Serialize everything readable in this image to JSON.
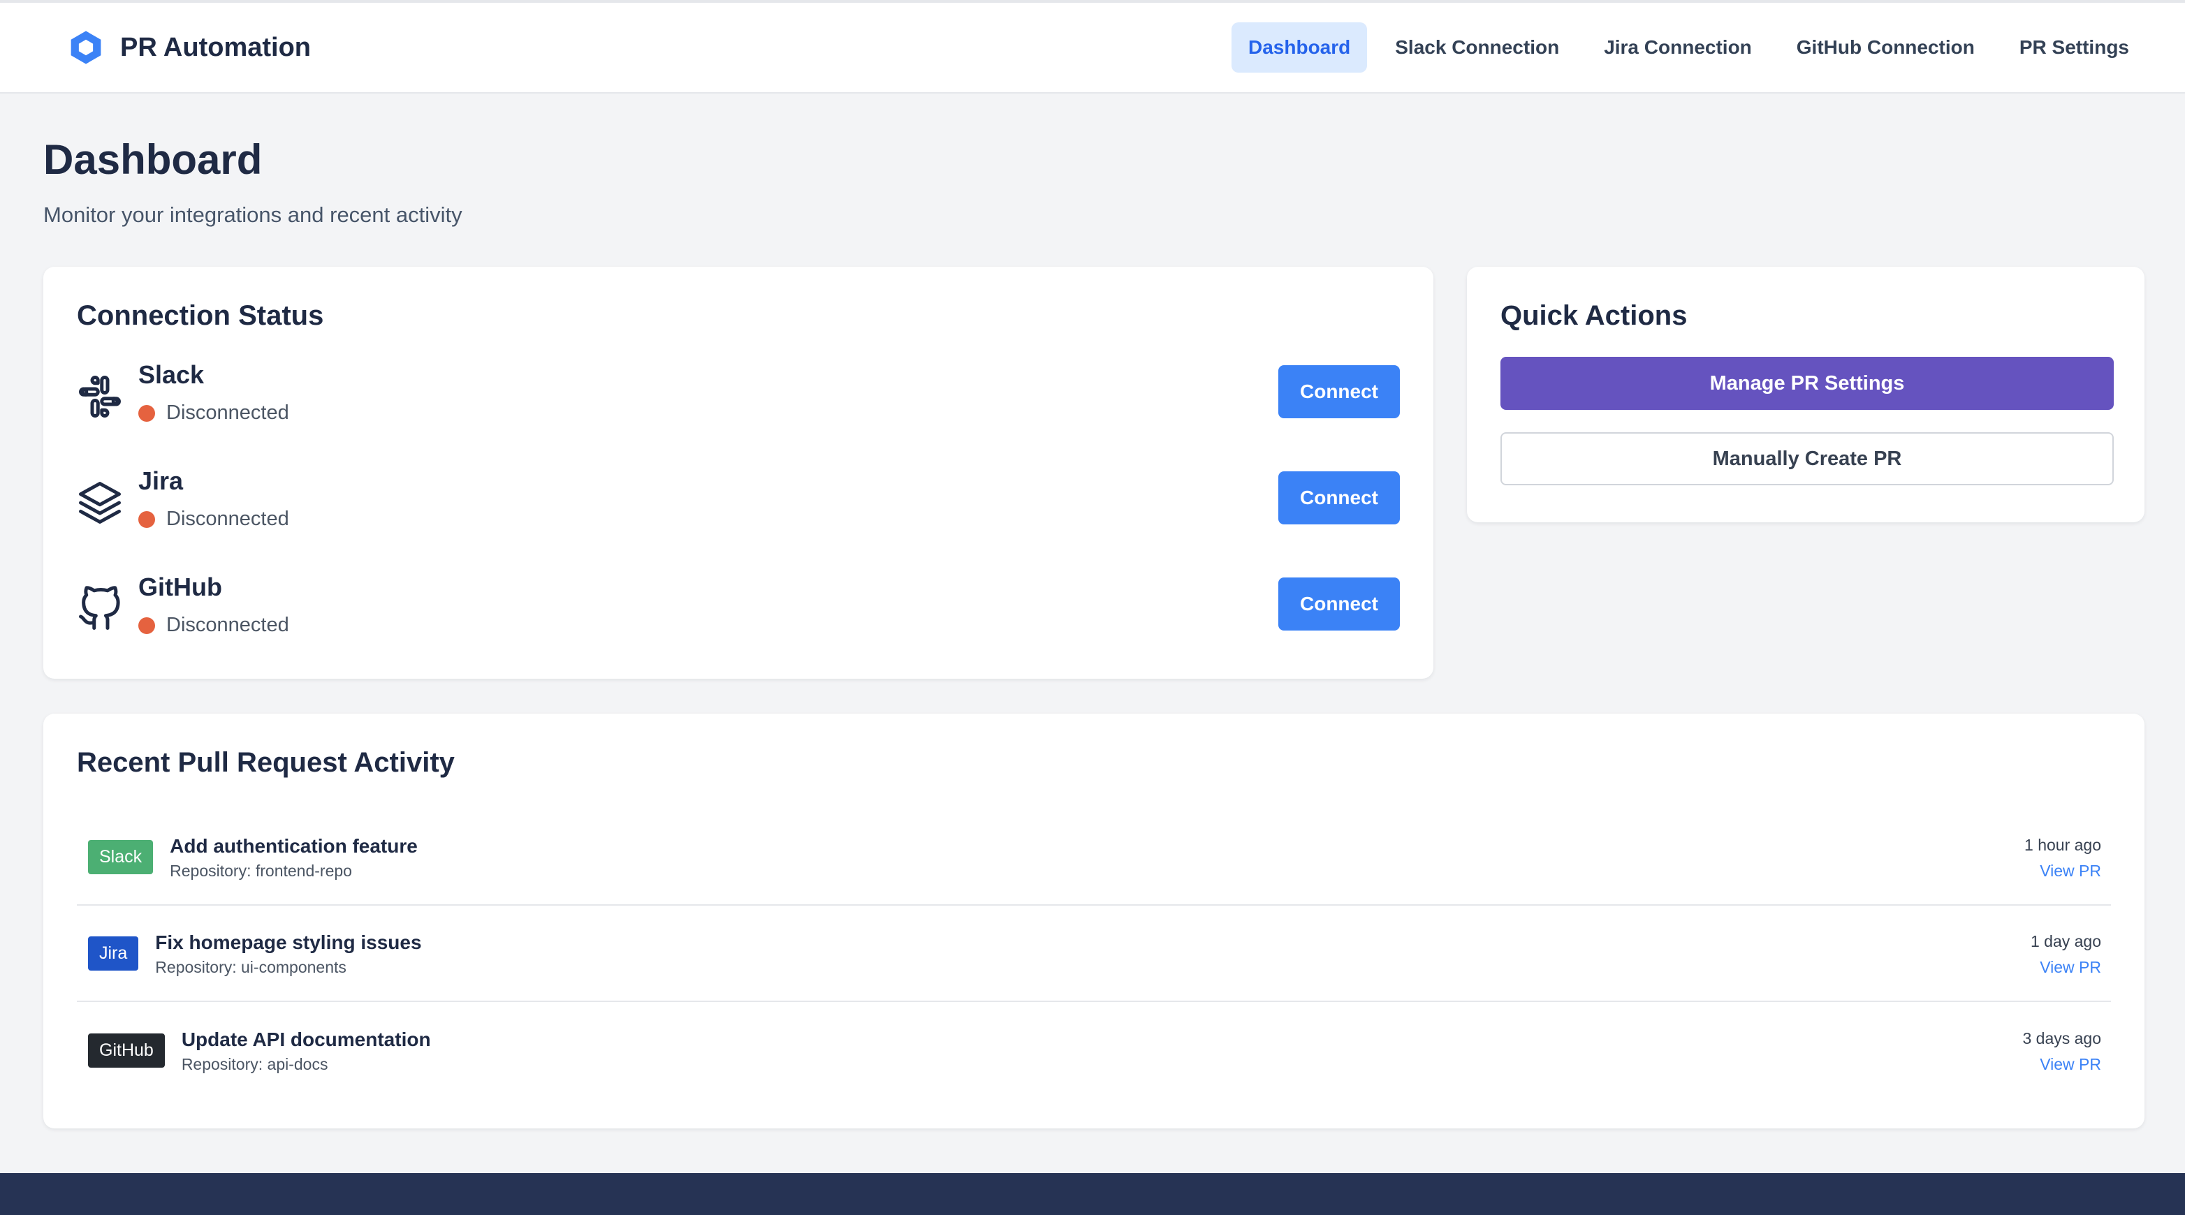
{
  "header": {
    "brand": "PR Automation",
    "nav": [
      {
        "label": "Dashboard",
        "active": true
      },
      {
        "label": "Slack Connection"
      },
      {
        "label": "Jira Connection"
      },
      {
        "label": "GitHub Connection"
      },
      {
        "label": "PR Settings"
      }
    ]
  },
  "page": {
    "title": "Dashboard",
    "subtitle": "Monitor your integrations and recent activity"
  },
  "connections": {
    "title": "Connection Status",
    "items": [
      {
        "name": "Slack",
        "status": "Disconnected",
        "button": "Connect",
        "icon": "slack-icon"
      },
      {
        "name": "Jira",
        "status": "Disconnected",
        "button": "Connect",
        "icon": "layers-icon"
      },
      {
        "name": "GitHub",
        "status": "Disconnected",
        "button": "Connect",
        "icon": "github-icon"
      }
    ]
  },
  "quick_actions": {
    "title": "Quick Actions",
    "primary": "Manage PR Settings",
    "secondary": "Manually Create PR"
  },
  "activity": {
    "title": "Recent Pull Request Activity",
    "items": [
      {
        "source": "Slack",
        "title": "Add authentication feature",
        "repo": "Repository: frontend-repo",
        "time": "1 hour ago",
        "link": "View PR"
      },
      {
        "source": "Jira",
        "title": "Fix homepage styling issues",
        "repo": "Repository: ui-components",
        "time": "1 day ago",
        "link": "View PR"
      },
      {
        "source": "GitHub",
        "title": "Update API documentation",
        "repo": "Repository: api-docs",
        "time": "3 days ago",
        "link": "View PR"
      }
    ]
  },
  "colors": {
    "accent": "#3b82f6",
    "primary_action": "#6553bf",
    "disconnected": "#e5623f",
    "footer": "#263354"
  }
}
